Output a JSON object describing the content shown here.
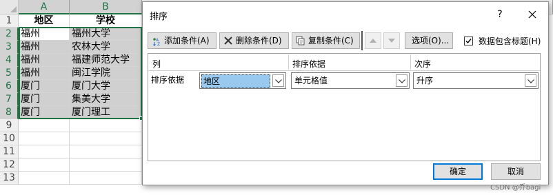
{
  "sheet": {
    "columns": [
      "A",
      "B"
    ],
    "rows": [
      "1",
      "2",
      "3",
      "4",
      "5",
      "6",
      "7",
      "8",
      "9",
      "10",
      "11",
      "12",
      "13"
    ],
    "header": [
      "地区",
      "学校"
    ],
    "data": [
      [
        "福州",
        "福州大学"
      ],
      [
        "福州",
        "农林大学"
      ],
      [
        "福州",
        "福建师范大学"
      ],
      [
        "福州",
        "闽江学院"
      ],
      [
        "厦门",
        "厦门大学"
      ],
      [
        "厦门",
        "集美大学"
      ],
      [
        "厦门",
        "厦门理工"
      ]
    ]
  },
  "dialog": {
    "title": "排序",
    "help": "?",
    "toolbar": {
      "add": "添加条件(A)",
      "delete": "删除条件(D)",
      "copy": "复制条件(C)",
      "options": "选项(O)..."
    },
    "has_headers_label": "数据包含标题(H)",
    "has_headers_checked": true,
    "grid_headers": {
      "column": "列",
      "sort_on": "排序依据",
      "order": "次序"
    },
    "row": {
      "label": "排序依据",
      "column_value": "地区",
      "sort_on_value": "单元格值",
      "order_value": "升序"
    },
    "ok": "确定",
    "cancel": "取消"
  },
  "watermark": "CSDN @乔bagi",
  "colors": {
    "excel_green": "#217346",
    "selection_fill": "#d0d0d0",
    "focus_blue": "#0078d7"
  }
}
